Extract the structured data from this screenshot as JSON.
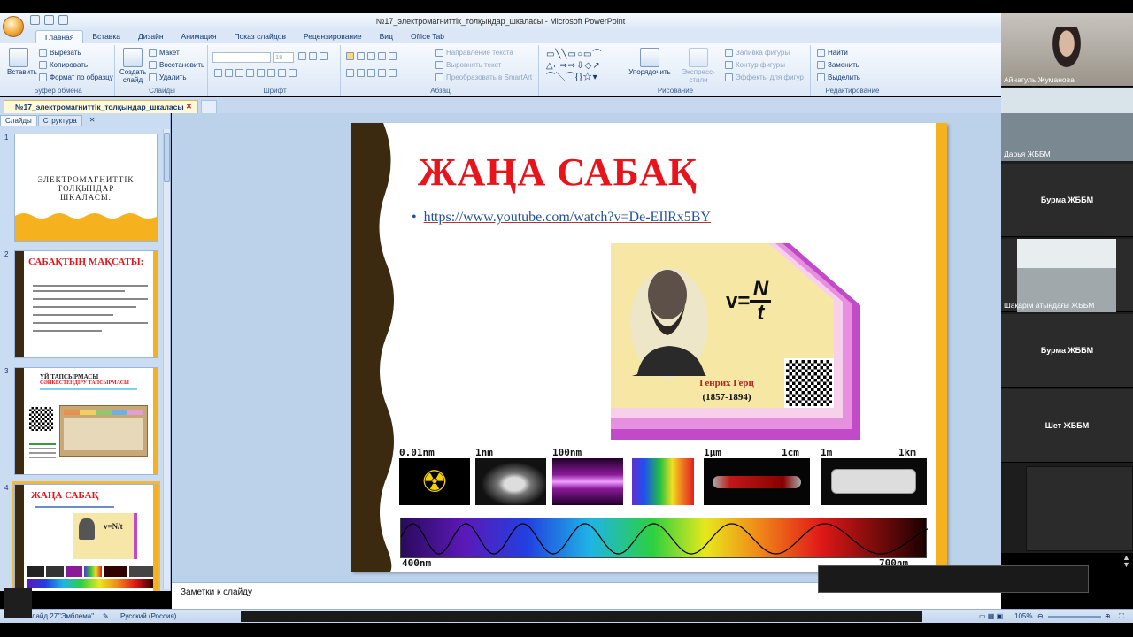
{
  "window": {
    "title": "№17_электромагниттік_толқындар_шкаласы - Microsoft PowerPoint"
  },
  "ribbon_tabs": [
    "Главная",
    "Вставка",
    "Дизайн",
    "Анимация",
    "Показ слайдов",
    "Рецензирование",
    "Вид",
    "Office Tab"
  ],
  "ribbon": {
    "clipboard": {
      "paste": "Вставить",
      "cut": "Вырезать",
      "copy": "Копировать",
      "format": "Формат по образцу",
      "name": "Буфер обмена"
    },
    "slides": {
      "new": "Создать слайд",
      "layout": "Макет",
      "reset": "Восстановить",
      "delete": "Удалить",
      "name": "Слайды"
    },
    "font": {
      "size": "18",
      "name": "Шрифт"
    },
    "paragraph": {
      "direction": "Направление текста",
      "align": "Выровнять текст",
      "smartart": "Преобразовать в SmartArt",
      "name": "Абзац"
    },
    "drawing": {
      "arrange": "Упорядочить",
      "styles": "Экспресс-стили",
      "fill": "Заливка фигуры",
      "outline": "Контур фигуры",
      "effects": "Эффекты для фигур",
      "name": "Рисование"
    },
    "editing": {
      "find": "Найти",
      "replace": "Заменить",
      "select": "Выделить",
      "name": "Редактирование"
    }
  },
  "doc_tab": {
    "label": "№17_электромагниттік_толқындар_шкаласы"
  },
  "panel_tabs": {
    "slides": "Слайды",
    "outline": "Структура"
  },
  "thumbnails": [
    {
      "num": "1",
      "title": "ЭЛЕКТРОМАГНИТТІК ТОЛҚЫНДАР ШКАЛАСЫ."
    },
    {
      "num": "2",
      "title": "САБАҚТЫҢ МАҚСАТЫ:"
    },
    {
      "num": "3",
      "title": "ҮЙ ТАПСЫРМАСЫ",
      "subtitle": "СӘЙКЕСТЕНДІРУ ТАПСЫРМАСЫ"
    },
    {
      "num": "4",
      "title": "ЖАҢА САБАҚ"
    }
  ],
  "slide": {
    "heading": "ЖАҢА САБАҚ",
    "link": "https://www.youtube.com/watch?v=De-EIlRx5BY",
    "formula_v": "v=",
    "formula_n": "N",
    "formula_t": "t",
    "person_name": "Генрих Герц",
    "person_years": "(1857-1894)",
    "spectrum_labels_top": [
      "0.01nm",
      "1nm",
      "100nm",
      "1μm",
      "1cm",
      "1m",
      "1km"
    ],
    "spectrum_labels_bottom": [
      "400nm",
      "700nm"
    ]
  },
  "notes": {
    "placeholder": "Заметки к слайду"
  },
  "status": {
    "slide": "Слайд 27",
    "theme": "\"Эмблема\"",
    "lang": "Русский (Россия)",
    "zoom": "105%"
  },
  "participants": [
    {
      "name": "Айнагуль Жуманова",
      "type": "video"
    },
    {
      "name": "Дарья ЖББМ",
      "type": "video"
    },
    {
      "name": "Бурма ЖББМ",
      "type": "label"
    },
    {
      "name": "Шақарім атындағы ЖББМ",
      "type": "video"
    },
    {
      "name": "Бурма ЖББМ",
      "type": "label"
    },
    {
      "name": "Шет ЖББМ",
      "type": "label"
    }
  ],
  "colors": {
    "heading_red": "#e8141c",
    "link_blue": "#1f5396",
    "accent_orange": "#f5b21e",
    "ribbon_bg": "#dce8f6"
  }
}
